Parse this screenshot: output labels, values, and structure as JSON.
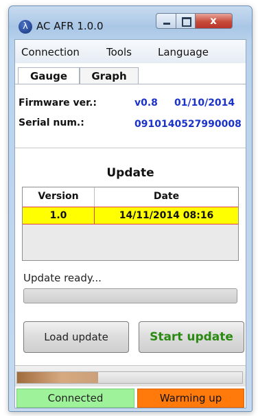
{
  "window": {
    "title": "AC AFR  1.0.0",
    "icon": "lambda-icon",
    "controls": {
      "minimize": "minimize-icon",
      "maximize": "maximize-icon",
      "close": "x"
    }
  },
  "menu": [
    {
      "label": "Connection"
    },
    {
      "label": "Tools"
    },
    {
      "label": "Language"
    }
  ],
  "tabs": [
    {
      "label": "Gauge",
      "selected": true
    },
    {
      "label": "Graph",
      "selected": false
    }
  ],
  "info": {
    "firmware_label": "Firmware ver.:",
    "firmware_version": "v0.8",
    "firmware_date": "01/10/2014",
    "serial_label": "Serial num.:",
    "serial_value": "0910140527990008"
  },
  "update": {
    "title": "Update",
    "columns": [
      "Version",
      "Date"
    ],
    "rows": [
      {
        "version": "1.0",
        "date": "14/11/2014  08:16",
        "selected": true
      }
    ],
    "status_text": "Update ready...",
    "progress": 0,
    "load_button": "Load update",
    "start_button": "Start update"
  },
  "status_bar": {
    "activity_progress": 0.36,
    "connection": "Connected",
    "state": "Warming up"
  },
  "colors": {
    "value_text": "#1a32c8",
    "selected_row": "#ffff00",
    "start_button_text": "#2a8a12",
    "connected_bg": "#9ef39a",
    "warming_bg": "#ff7a0a"
  }
}
